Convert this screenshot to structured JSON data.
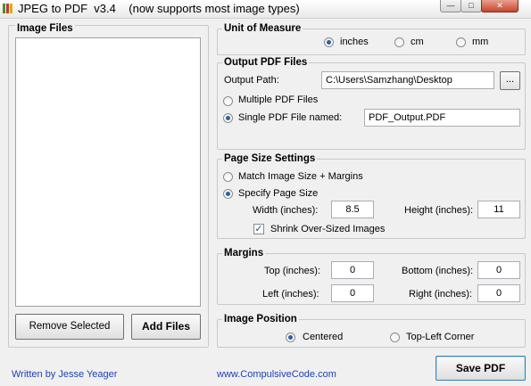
{
  "window": {
    "title": "JPEG to PDF  v3.4    (now supports most image types)",
    "minimize_icon": "minimize-icon",
    "maximize_icon": "maximize-icon",
    "close_icon": "close-icon",
    "minimize_glyph": "—",
    "maximize_glyph": "□",
    "close_glyph": "✕"
  },
  "image_files": {
    "title": "Image Files",
    "remove_label": "Remove Selected",
    "add_label": "Add Files"
  },
  "unit_of_measure": {
    "title": "Unit of Measure",
    "options": [
      "inches",
      "cm",
      "mm"
    ],
    "selected": "inches"
  },
  "output_pdf": {
    "title": "Output PDF Files",
    "path_label": "Output Path:",
    "path_value": "C:\\Users\\Samzhang\\Desktop",
    "browse_label": "...",
    "multiple_label": "Multiple PDF Files",
    "single_label": "Single PDF File named:",
    "single_selected": true,
    "filename": "PDF_Output.PDF"
  },
  "page_size": {
    "title": "Page Size Settings",
    "match_label": "Match Image Size + Margins",
    "specify_label": "Specify Page Size",
    "specify_selected": true,
    "width_label": "Width (inches):",
    "width_value": "8.5",
    "height_label": "Height (inches):",
    "height_value": "11",
    "shrink_label": "Shrink Over-Sized Images",
    "shrink_checked": true,
    "check_glyph": "✓"
  },
  "margins": {
    "title": "Margins",
    "top_label": "Top (inches):",
    "top_value": "0",
    "bottom_label": "Bottom (inches):",
    "bottom_value": "0",
    "left_label": "Left (inches):",
    "left_value": "0",
    "right_label": "Right (inches):",
    "right_value": "0"
  },
  "image_position": {
    "title": "Image Position",
    "centered_label": "Centered",
    "topleft_label": "Top-Left Corner",
    "selected": "Centered"
  },
  "footer": {
    "author": "Written by Jesse Yeager",
    "website": "www.CompulsiveCode.com",
    "save_label": "Save PDF"
  }
}
